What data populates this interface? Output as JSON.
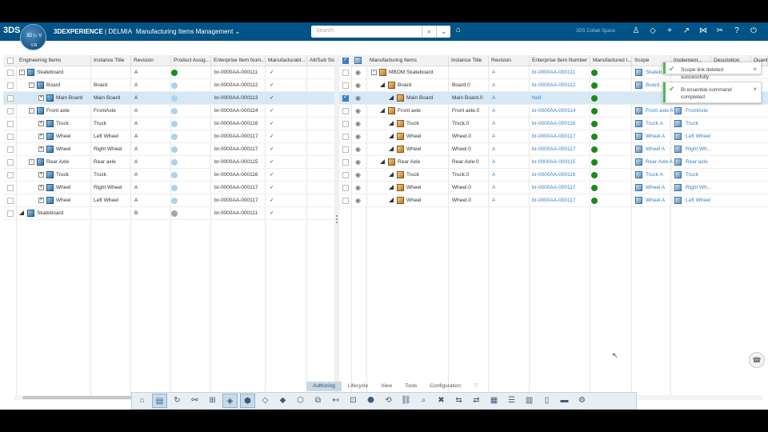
{
  "header": {
    "ds_logo": "3DS",
    "compass_text": "3D ▷ V",
    "compass_user": "V,R",
    "brand_bold": "3DEXPERIENCE",
    "brand_rest": " | DELMIA",
    "app_title": "Manufacturing Items Management",
    "app_caret": "⌄",
    "search_placeholder": "Search",
    "search_icon": "⌕",
    "search_menu_icon": "⌄",
    "tag_icon": "⌂",
    "user_info": "3DS Collab Space",
    "icons": [
      {
        "name": "user-icon",
        "glyph": "♙"
      },
      {
        "name": "tag-icon",
        "glyph": "◇"
      },
      {
        "name": "add-icon",
        "glyph": "+"
      },
      {
        "name": "share-icon",
        "glyph": "↗"
      },
      {
        "name": "network-icon",
        "glyph": "⋈"
      },
      {
        "name": "tools-icon",
        "glyph": "✂"
      },
      {
        "name": "help-icon",
        "glyph": "?"
      },
      {
        "name": "power-icon",
        "glyph": "⏻"
      }
    ]
  },
  "left": {
    "columns": [
      "Engineering Items",
      "Instance Title",
      "Revision",
      "Product Assig...",
      "Enterprise Item Num...",
      "Manufacturabl...",
      "Alt/Sub Stat"
    ],
    "rows": [
      {
        "indent": 0,
        "exp": "-",
        "title": "Skateboard",
        "inst": "",
        "rev": "A",
        "status": "#1a8a1a",
        "ein": "br-0000AA-000111",
        "mfg": "✓"
      },
      {
        "indent": 1,
        "exp": "-",
        "title": "Board",
        "inst": "Board",
        "rev": "A",
        "status": "#a8d4ee",
        "ein": "br-0000AA-000112",
        "mfg": "✓"
      },
      {
        "indent": 2,
        "exp": "+",
        "title": "Main Board",
        "inst": "Main Board",
        "rev": "A",
        "status": "#a8d4ee",
        "ein": "br-0000AA-000113",
        "mfg": "✓",
        "selected": true
      },
      {
        "indent": 1,
        "exp": "-",
        "title": "Front axle",
        "inst": "FrontAxle",
        "rev": "A",
        "status": "#a8d4ee",
        "ein": "br-0000AA-000114",
        "mfg": "✓"
      },
      {
        "indent": 2,
        "exp": "+",
        "title": "Truck",
        "inst": "Truck",
        "rev": "A",
        "status": "#a8d4ee",
        "ein": "br-0000AA-000116",
        "mfg": "✓"
      },
      {
        "indent": 2,
        "exp": "+",
        "title": "Wheel",
        "inst": "Left Wheel",
        "rev": "A",
        "status": "#a8d4ee",
        "ein": "br-0000AA-000117",
        "mfg": "✓"
      },
      {
        "indent": 2,
        "exp": "+",
        "title": "Wheel",
        "inst": "Right Wheel",
        "rev": "A",
        "status": "#a8d4ee",
        "ein": "br-0000AA-000117",
        "mfg": "✓"
      },
      {
        "indent": 1,
        "exp": "-",
        "title": "Rear Axle",
        "inst": "Rear axle",
        "rev": "A",
        "status": "#a8d4ee",
        "ein": "br-0000AA-000115",
        "mfg": "✓"
      },
      {
        "indent": 2,
        "exp": "+",
        "title": "Truck",
        "inst": "Truck",
        "rev": "A",
        "status": "#a8d4ee",
        "ein": "br-0000AA-000116",
        "mfg": "✓"
      },
      {
        "indent": 2,
        "exp": "+",
        "title": "Wheel",
        "inst": "Right Wheel",
        "rev": "A",
        "status": "#a8d4ee",
        "ein": "br-0000AA-000117",
        "mfg": "✓"
      },
      {
        "indent": 2,
        "exp": "+",
        "title": "Wheel",
        "inst": "Left Wheel",
        "rev": "A",
        "status": "#a8d4ee",
        "ein": "br-0000AA-000117",
        "mfg": "✓"
      },
      {
        "indent": 0,
        "exp": "tri",
        "title": "Skateboard",
        "inst": "",
        "rev": "B",
        "status": "#a6a6a6",
        "ein": "br-0000AA-000111",
        "mfg": "✓"
      }
    ]
  },
  "right": {
    "columns": [
      "Manufacturing Items",
      "Instance Title",
      "Revision",
      "Enterprise Item Number",
      "Manufactured I...",
      "Scope",
      "Implement...",
      "Description",
      "Quant"
    ],
    "rows": [
      {
        "indent": 0,
        "exp": "-",
        "title": "MBOM Skateboard",
        "inst": "",
        "rev": "A",
        "ein": "br-0000AA-000111",
        "scope": "Skateb...",
        "impl": ""
      },
      {
        "indent": 1,
        "exp": "tri",
        "title": "Board",
        "inst": "Board.0",
        "rev": "A",
        "ein": "br-0000AA-000112",
        "scope": "Board...",
        "impl": ""
      },
      {
        "indent": 2,
        "exp": "tri",
        "title": "Main Board",
        "inst": "Main Board.0",
        "rev": "A",
        "ein": "Null",
        "scope": "",
        "impl": "",
        "selected": true
      },
      {
        "indent": 1,
        "exp": "tri",
        "title": "Front axle",
        "inst": "Front axle.0",
        "rev": "A",
        "ein": "br-0000AA-000114",
        "scope": "Front axle A",
        "impl": "FrontAxle"
      },
      {
        "indent": 2,
        "exp": "tri",
        "title": "Truck",
        "inst": "Truck.0",
        "rev": "A",
        "ein": "br-0000AA-000116",
        "scope": "Truck A",
        "impl": "Truck"
      },
      {
        "indent": 2,
        "exp": "tri",
        "title": "Wheel",
        "inst": "Wheel.0",
        "rev": "A",
        "ein": "br-0000AA-000117",
        "scope": "Wheel A",
        "impl": "Left Wheel"
      },
      {
        "indent": 2,
        "exp": "tri",
        "title": "Wheel",
        "inst": "Wheel.0",
        "rev": "A",
        "ein": "br-0000AA-000117",
        "scope": "Wheel A",
        "impl": "Right Wh..."
      },
      {
        "indent": 1,
        "exp": "tri",
        "title": "Rear Axle",
        "inst": "Rear Axle.0",
        "rev": "A",
        "ein": "br-0000AA-000115",
        "scope": "Rear Axle A",
        "impl": "Rear axle"
      },
      {
        "indent": 2,
        "exp": "tri",
        "title": "Truck",
        "inst": "Truck.0",
        "rev": "A",
        "ein": "br-0000AA-000116",
        "scope": "Truck A",
        "impl": "Truck"
      },
      {
        "indent": 2,
        "exp": "tri",
        "title": "Wheel",
        "inst": "Wheel.0",
        "rev": "A",
        "ein": "br-0000AA-000117",
        "scope": "Wheel A",
        "impl": "Right Wh..."
      },
      {
        "indent": 2,
        "exp": "tri",
        "title": "Wheel",
        "inst": "Wheel.0",
        "rev": "A",
        "ein": "br-0000AA-000117",
        "scope": "Wheel A",
        "impl": "Left Wheel"
      }
    ]
  },
  "toasts": [
    {
      "message": "Scope link deleted successfully",
      "close": "×"
    },
    {
      "message": "Bi essential command completed",
      "close": "×"
    }
  ],
  "bottom_tabs": [
    "Authoring",
    "Lifecycle",
    "View",
    "Tools",
    "Configuration",
    "♡"
  ],
  "toolbar": [
    {
      "name": "home-icon",
      "glyph": "⌂"
    },
    {
      "name": "database-icon",
      "glyph": "▤",
      "active": true
    },
    {
      "name": "sync-icon",
      "glyph": "↻"
    },
    {
      "name": "link-icon",
      "glyph": "⚯"
    },
    {
      "name": "tree-icon",
      "glyph": "⊞"
    },
    {
      "name": "assign-icon",
      "glyph": "◈",
      "active": true
    },
    {
      "name": "cube-icon",
      "glyph": "⬢",
      "active": true
    },
    {
      "name": "part-icon",
      "glyph": "◇"
    },
    {
      "name": "insert-icon",
      "glyph": "◆"
    },
    {
      "name": "replace-icon",
      "glyph": "⬡"
    },
    {
      "name": "structure-icon",
      "glyph": "⧉"
    },
    {
      "name": "move-icon",
      "glyph": "↤"
    },
    {
      "name": "scope-icon",
      "glyph": "⊡"
    },
    {
      "name": "product-icon",
      "glyph": "⬣"
    },
    {
      "name": "rotate-icon",
      "glyph": "⟲"
    },
    {
      "name": "chain-icon",
      "glyph": "⛓"
    },
    {
      "name": "search-icon",
      "glyph": "⌕"
    },
    {
      "name": "delete-icon",
      "glyph": "✖"
    },
    {
      "name": "swap-icon",
      "glyph": "⇆"
    },
    {
      "name": "compare-icon",
      "glyph": "⇄"
    },
    {
      "name": "grid-icon",
      "glyph": "▦"
    },
    {
      "name": "list-icon",
      "glyph": "☰"
    },
    {
      "name": "columns-icon",
      "glyph": "▥"
    },
    {
      "name": "panel-icon",
      "glyph": "▯"
    },
    {
      "name": "export-icon",
      "glyph": "▬"
    },
    {
      "name": "settings-icon",
      "glyph": "⚙"
    }
  ],
  "chat_icon": "☎",
  "cursor_glyph": "↖"
}
